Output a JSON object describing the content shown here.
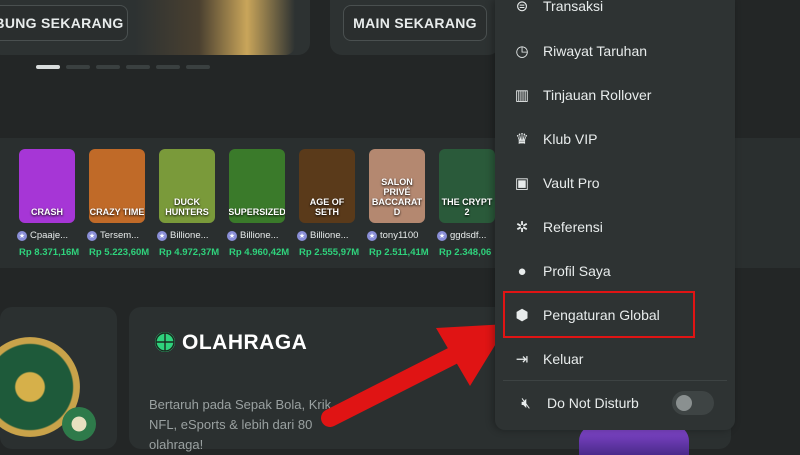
{
  "banners": {
    "left_button": "BUNG SEKARANG",
    "right_button": "MAIN SEKARANG"
  },
  "games": [
    {
      "name": "CRASH",
      "color": "#a636d6"
    },
    {
      "name": "CRAZY TIME",
      "color": "#c06a28"
    },
    {
      "name": "DUCK HUNTERS",
      "color": "#7a9a3a"
    },
    {
      "name": "SUPERSIZED",
      "color": "#3a7a2a"
    },
    {
      "name": "AGE OF SETH",
      "color": "#5a3a1a"
    },
    {
      "name": "SALON PRIVÉ BACCARAT D",
      "color": "#b48870"
    },
    {
      "name": "THE CRYPT 2",
      "color": "#2a5a3a"
    }
  ],
  "players": [
    "Cpaaje...",
    "Tersem...",
    "Billione...",
    "Billione...",
    "Billione...",
    "tony1100",
    "ggdsdf..."
  ],
  "amounts": [
    "Rp 8.371,16M",
    "Rp 5.223,60M",
    "Rp 4.972,37M",
    "Rp 4.960,42M",
    "Rp 2.555,97M",
    "Rp 2.511,41M",
    "Rp 2.348,06"
  ],
  "sports": {
    "title": "OLAHRAGA",
    "description": "Bertaruh pada Sepak Bola, Krik... NFL, eSports & lebih dari 80 olahraga!"
  },
  "menu": {
    "items": [
      {
        "label": "Transaksi",
        "icon": "transaction-icon"
      },
      {
        "label": "Riwayat Taruhan",
        "icon": "clock-icon"
      },
      {
        "label": "Tinjauan Rollover",
        "icon": "bar-chart-icon"
      },
      {
        "label": "Klub VIP",
        "icon": "crown-icon"
      },
      {
        "label": "Vault Pro",
        "icon": "vault-icon"
      },
      {
        "label": "Referensi",
        "icon": "referral-icon"
      },
      {
        "label": "Profil Saya",
        "icon": "user-icon"
      },
      {
        "label": "Pengaturan Global",
        "icon": "settings-icon"
      },
      {
        "label": "Keluar",
        "icon": "logout-icon"
      }
    ],
    "dnd_label": "Do Not Disturb",
    "dnd_enabled": false
  }
}
